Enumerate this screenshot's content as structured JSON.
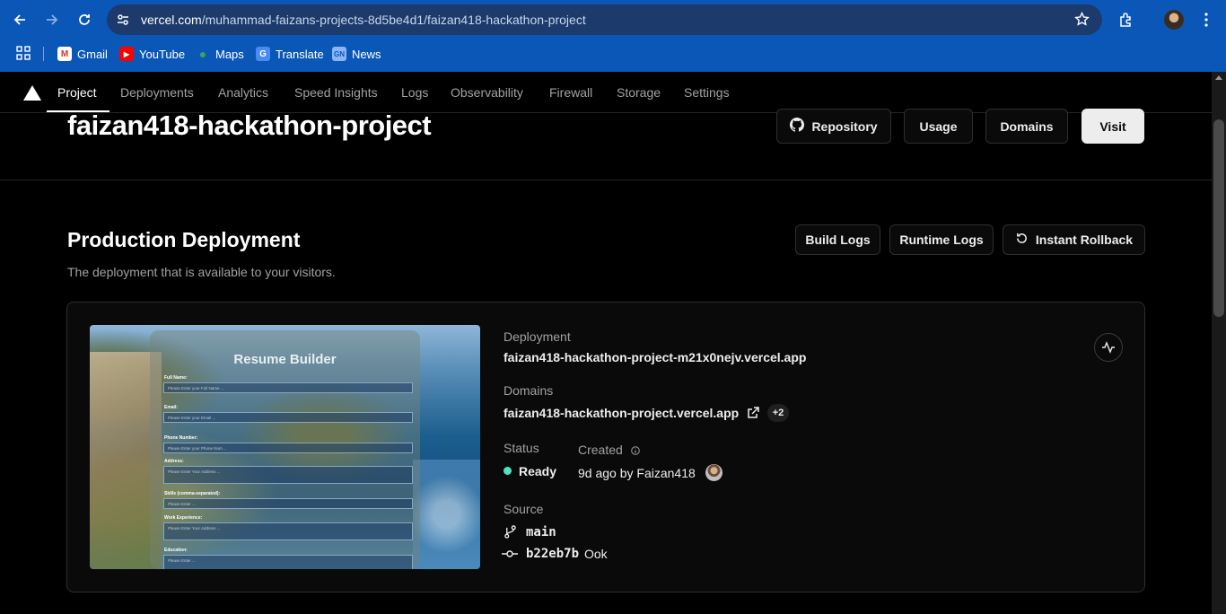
{
  "browser": {
    "url_host": "vercel.com",
    "url_path": "/muhammad-faizans-projects-8d5be4d1/faizan418-hackathon-project",
    "bookmarks": [
      {
        "label": "Gmail",
        "icon": "gmail-icon"
      },
      {
        "label": "YouTube",
        "icon": "youtube-icon"
      },
      {
        "label": "Maps",
        "icon": "maps-icon"
      },
      {
        "label": "Translate",
        "icon": "translate-icon"
      },
      {
        "label": "News",
        "icon": "news-icon"
      }
    ]
  },
  "nav": {
    "tabs": [
      {
        "label": "Project",
        "active": true
      },
      {
        "label": "Deployments"
      },
      {
        "label": "Analytics"
      },
      {
        "label": "Speed Insights"
      },
      {
        "label": "Logs"
      },
      {
        "label": "Observability"
      },
      {
        "label": "Firewall"
      },
      {
        "label": "Storage"
      },
      {
        "label": "Settings"
      }
    ]
  },
  "header": {
    "title": "faizan418-hackathon-project",
    "buttons": {
      "repository": "Repository",
      "usage": "Usage",
      "domains": "Domains",
      "visit": "Visit"
    }
  },
  "production": {
    "title": "Production Deployment",
    "subtitle": "The deployment that is available to your visitors.",
    "buttons": {
      "build_logs": "Build Logs",
      "runtime_logs": "Runtime Logs",
      "instant_rollback": "Instant Rollback"
    },
    "preview": {
      "title": "Resume Builder",
      "fields": [
        {
          "label": "Full Name:",
          "placeholder": "Please Enter your Full Name ..."
        },
        {
          "label": "Email:",
          "placeholder": "Please Enter your Email ..."
        },
        {
          "label": "Phone Number:",
          "placeholder": "Please Enter your Phone Num ..."
        },
        {
          "label": "Address:",
          "placeholder": "Please Enter Your Address ..."
        },
        {
          "label": "Skills (comma-separated):",
          "placeholder": "Please Enter ..."
        },
        {
          "label": "Work Experience:",
          "placeholder": "Please Enter Your Address ..."
        },
        {
          "label": "Education:",
          "placeholder": "Please Enter ..."
        }
      ]
    },
    "deployment_label": "Deployment",
    "deployment_url": "faizan418-hackathon-project-m21x0nejv.vercel.app",
    "domains_label": "Domains",
    "domain": "faizan418-hackathon-project.vercel.app",
    "domain_extra": "+2",
    "status_label": "Status",
    "status": "Ready",
    "status_color": "#50e3c2",
    "created_label": "Created",
    "created": "9d ago by Faizan418",
    "source_label": "Source",
    "branch": "main",
    "commit_hash": "b22eb7b",
    "commit_message": "Ook"
  }
}
